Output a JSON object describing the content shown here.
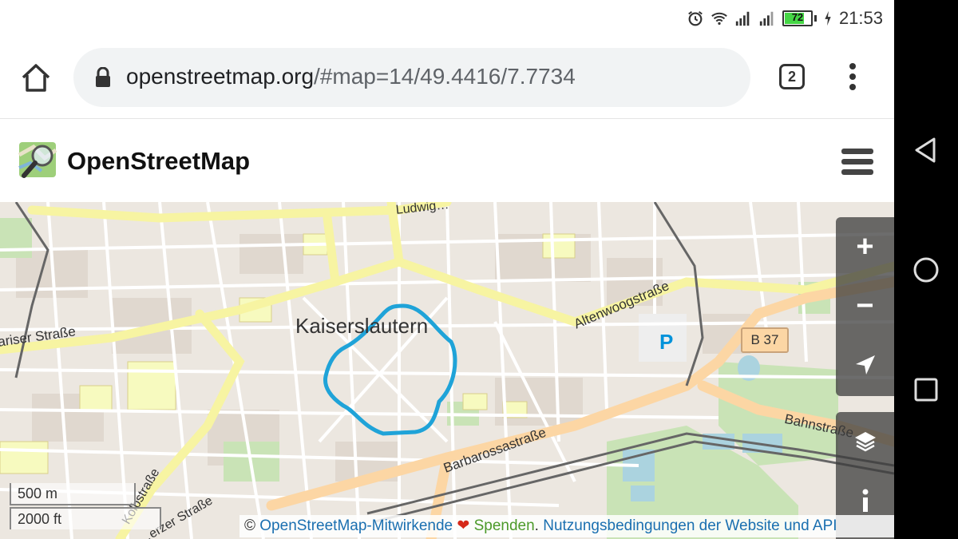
{
  "status_bar": {
    "time": "21:53",
    "battery_level": "72",
    "icons": [
      "alarm-icon",
      "wifi-icon",
      "signal-icon",
      "signal-icon",
      "battery-icon",
      "charging-icon"
    ]
  },
  "browser": {
    "url_host": "openstreetmap.org",
    "url_path": "/#map=14/49.4416/7.7734",
    "tab_count": "2"
  },
  "site": {
    "title": "OpenStreetMap"
  },
  "map": {
    "city_label": "Kaiserslautern",
    "street_labels": [
      "ariser Straße",
      "Altenwoogstraße",
      "Barbarossastraße",
      "Bahnstraße",
      "Kolbstraße",
      "…erzer Straße",
      "Ludwig…"
    ],
    "road_shield": "B 37",
    "parking_label": "P",
    "route_color": "#1fa3d8",
    "highlight_color": "#f7fabf"
  },
  "controls": {
    "zoom_in": "+",
    "zoom_out": "−"
  },
  "scale": {
    "metric": "500 m",
    "imperial": "2000 ft"
  },
  "attribution": {
    "copyright": "©",
    "contributors": "OpenStreetMap-Mitwirkende",
    "donate": "Spenden",
    "period": ".",
    "terms": "Nutzungsbedingungen der Website und API"
  }
}
